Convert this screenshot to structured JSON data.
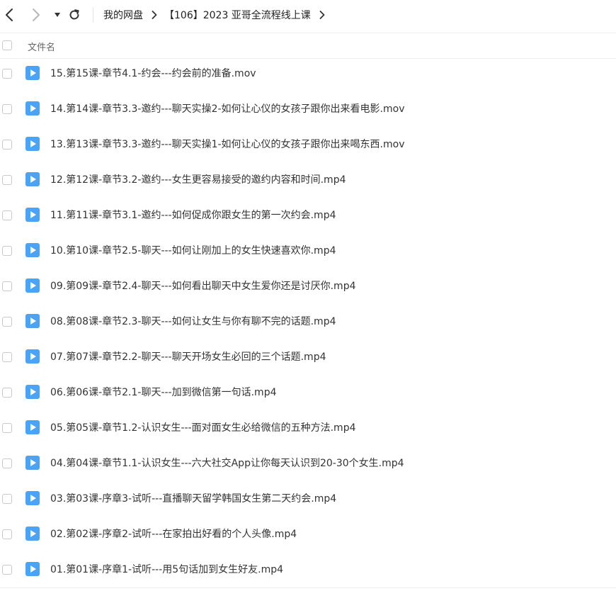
{
  "breadcrumb": {
    "items": [
      "我的网盘",
      "【106】2023 亚哥全流程线上课"
    ]
  },
  "table": {
    "header": "文件名",
    "rows": [
      "15.第15课-章节4.1-约会---约会前的准备.mov",
      "14.第14课-章节3.3-邀约---聊天实操2-如何让心仪的女孩子跟你出来看电影.mov",
      "13.第13课-章节3.3-邀约---聊天实操1-如何让心仪的女孩子跟你出来喝东西.mov",
      "12.第12课-章节3.2-邀约---女生更容易接受的邀约内容和时间.mp4",
      "11.第11课-章节3.1-邀约---如何促成你跟女生的第一次约会.mp4",
      "10.第10课-章节2.5-聊天---如何让刚加上的女生快速喜欢你.mp4",
      "09.第09课-章节2.4-聊天---如何看出聊天中女生爱你还是讨厌你.mp4",
      "08.第08课-章节2.3-聊天---如何让女生与你有聊不完的话题.mp4",
      "07.第07课-章节2.2-聊天---聊天开场女生必回的三个话题.mp4",
      "06.第06课-章节2.1-聊天---加到微信第一句话.mp4",
      "05.第05课-章节1.2-认识女生---面对面女生必给微信的五种方法.mp4",
      "04.第04课-章节1.1-认识女生---六大社交App让你每天认识到20-30个女生.mp4",
      "03.第03课-序章3-试听---直播聊天留学韩国女生第二天约会.mp4",
      "02.第02课-序章2-试听---在家拍出好看的个人头像.mp4",
      "01.第01课-序章1-试听---用5句话加到女生好友.mp4"
    ]
  },
  "icons": {
    "back": "chevron-left-icon",
    "forward": "chevron-right-icon",
    "history": "caret-down-icon",
    "refresh": "refresh-icon",
    "file": "video-file-icon"
  },
  "colors": {
    "video_icon": "#4aa3f4",
    "text": "#333333",
    "muted": "#666666"
  }
}
